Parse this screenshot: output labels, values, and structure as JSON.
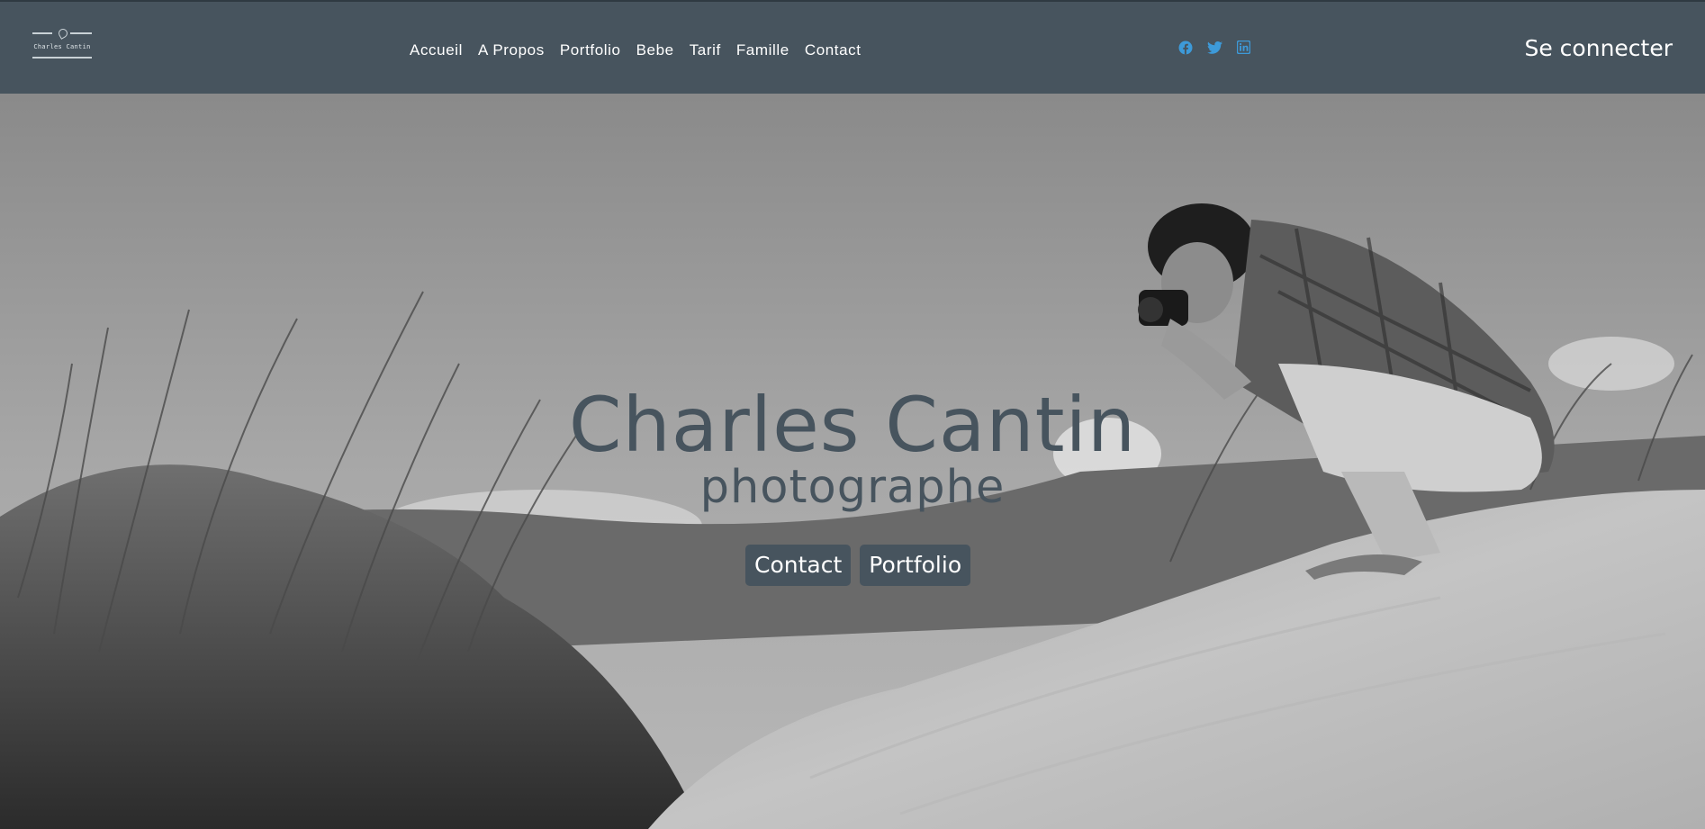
{
  "header": {
    "logo": {
      "text": "Charles Cantin"
    },
    "nav": [
      {
        "label": "Accueil"
      },
      {
        "label": "A Propos"
      },
      {
        "label": "Portfolio"
      },
      {
        "label": "Bebe"
      },
      {
        "label": "Tarif"
      },
      {
        "label": "Famille"
      },
      {
        "label": "Contact"
      }
    ],
    "social_icons": [
      "facebook-icon",
      "twitter-icon",
      "linkedin-icon"
    ],
    "social_color": "#3d9ad9",
    "login_label": "Se connecter"
  },
  "hero": {
    "title": "Charles Cantin",
    "subtitle": "photographe",
    "buttons": [
      {
        "label": "Contact"
      },
      {
        "label": "Portfolio"
      }
    ]
  },
  "colors": {
    "header_bg": "#47545e",
    "accent": "#47545e",
    "text_light": "#ffffff"
  }
}
